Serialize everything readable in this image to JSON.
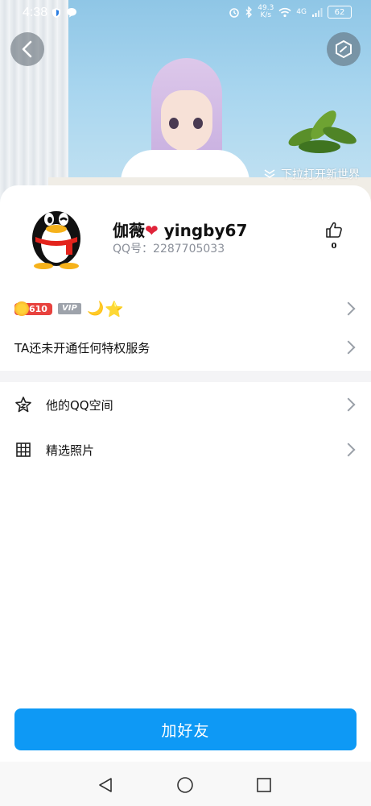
{
  "status_bar": {
    "time": "4:38",
    "network_speed_value": "49.3",
    "network_speed_unit": "K/s",
    "signal_label": "4G",
    "battery": "62"
  },
  "banner": {
    "pull_hint": "下拉打开新世界"
  },
  "profile": {
    "name_prefix": "伽薇",
    "heart": "❤",
    "name_suffix": " yingby67",
    "qq_label": "QQ号：",
    "qq_number": "2287705033",
    "like_count": "0"
  },
  "badges": {
    "level_value": "610",
    "vip_label": "VIP",
    "moon": "🌙",
    "star": "⭐"
  },
  "privilege": {
    "text": "TA还未开通任何特权服务"
  },
  "menu": {
    "items": [
      {
        "label": "他的QQ空间",
        "icon": "star-outline-icon"
      },
      {
        "label": "精选照片",
        "icon": "grid-icon"
      }
    ]
  },
  "actions": {
    "add_friend_label": "加好友"
  },
  "colors": {
    "accent": "#0e99f5",
    "level_badge": "#e8423e",
    "vip_badge": "#9ea3ab",
    "heart": "#e0243a"
  }
}
